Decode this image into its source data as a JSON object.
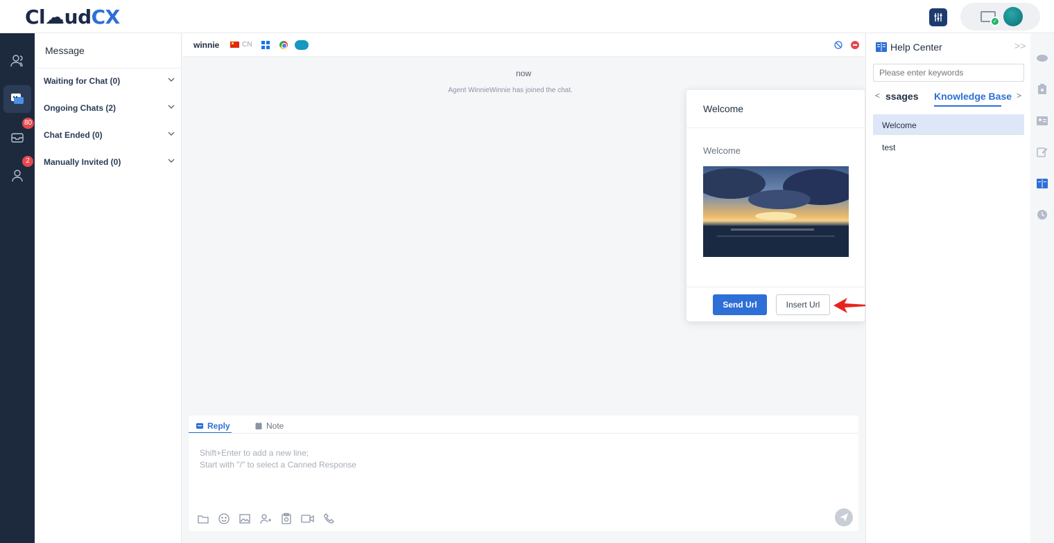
{
  "app": {
    "logo_part1": "Cl☁ud",
    "logo_part2": "CX"
  },
  "leftnav": {
    "items": [
      {
        "name": "contacts",
        "badge": ""
      },
      {
        "name": "chat",
        "badge": ""
      },
      {
        "name": "inbox",
        "badge": "80"
      },
      {
        "name": "agents",
        "badge": "2"
      }
    ]
  },
  "message_panel": {
    "title": "Message",
    "sections": [
      {
        "label": "Waiting for Chat (0)"
      },
      {
        "label": "Ongoing Chats (2)"
      },
      {
        "label": "Chat Ended (0)"
      },
      {
        "label": "Manually Invited (0)"
      }
    ]
  },
  "chat": {
    "visitor": "winnie",
    "country": "CN",
    "timestamp": "now",
    "system_message": "Agent WinnieWinnie has joined the chat."
  },
  "popup": {
    "title": "Welcome",
    "body": "Welcome",
    "send_label": "Send Url",
    "insert_label": "Insert Url"
  },
  "reply": {
    "tab_reply": "Reply",
    "tab_note": "Note",
    "placeholder_line1": "Shift+Enter to add a new line;",
    "placeholder_line2": "Start with \"/\" to select a Canned Response"
  },
  "help_center": {
    "title": "Help Center",
    "search_placeholder": "Please enter keywords",
    "tabs": [
      "ssages",
      "Knowledge Base"
    ],
    "active_tab": "Knowledge Base",
    "items": [
      "Welcome",
      "test"
    ],
    "selected_item": "Welcome"
  },
  "colors": {
    "accent": "#2d6fd6",
    "nav_bg": "#1d2a3e",
    "badge": "#e5484d",
    "arrow": "#e8231d"
  }
}
